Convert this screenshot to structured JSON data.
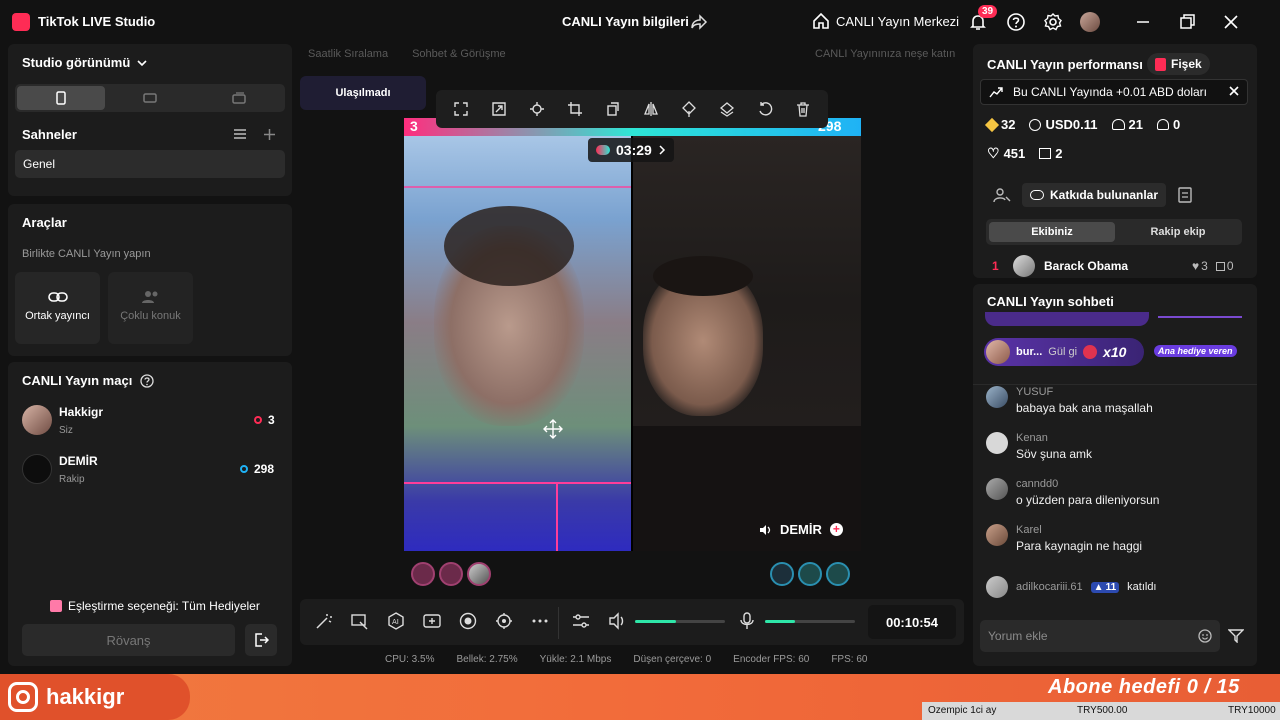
{
  "titlebar": {
    "app_name": "TikTok LIVE Studio",
    "center_title": "CANLI Yayın bilgileri",
    "live_center": "CANLI Yayın Merkezi",
    "notif_count": "39"
  },
  "studio": {
    "view_title": "Studio görünümü",
    "scenes_title": "Sahneler",
    "scene_item": "Genel"
  },
  "tools": {
    "title": "Araçlar",
    "subtitle": "Birlikte CANLI Yayın yapın",
    "cohost": "Ortak yayıncı",
    "multi_guest": "Çoklu konuk"
  },
  "match": {
    "title": "CANLI Yayın maçı",
    "me_name": "Hakkigr",
    "me_role": "Siz",
    "me_score": "3",
    "opp_name": "DEMİR",
    "opp_role": "Rakip",
    "opp_score": "298",
    "pairing": "Eşleştirme seçeneği: Tüm Hediyeler",
    "rematch": "Rövanş"
  },
  "center": {
    "tab1": "Saatlik Sıralama",
    "tab2": "Sohbet & Görüşme",
    "tab3": "CANLI Yayınınıza neşe katın",
    "unreached": "Ulaşılmadı",
    "timer": "03:29",
    "left_score": "3",
    "right_score": "298",
    "opp_label": "DEMİR",
    "live_time": "00:10:54"
  },
  "stats": {
    "cpu": "CPU: 3.5%",
    "memory": "Bellek: 2.75%",
    "upload": "Yükle: 2.1 Mbps",
    "dropped": "Düşen çerçeve: 0",
    "encoder": "Encoder FPS: 60",
    "fps": "FPS: 60"
  },
  "performance": {
    "title": "CANLI Yayın performansı",
    "fisek": "Fişek",
    "banner": "Bu CANLI Yayında +0.01 ABD doları",
    "diamonds": "32",
    "usd": "USD0.11",
    "viewers": "21",
    "new_followers": "0",
    "likes": "451",
    "gifts": "2",
    "contributors": "Katkıda bulunanlar",
    "tab_team": "Ekibiniz",
    "tab_rival": "Rakip ekip",
    "rank": "1",
    "top_name": "Barack Obama",
    "top_likes": "3",
    "top_gifts": "0"
  },
  "chat": {
    "title": "CANLI Yayın sohbeti",
    "gift_user": "bur...",
    "gift_text": "Gül gi",
    "gift_count": "x10",
    "gift_badge": "Ana hediye veren",
    "messages": [
      {
        "name": "YUSUF",
        "text": "babaya bak ana maşallah"
      },
      {
        "name": "Kenan",
        "text": "Söv şuna amk"
      },
      {
        "name": "canndd0",
        "text": "o yüzden para dileniyorsun"
      },
      {
        "name": "Karel",
        "text": "Para kaynagin ne haggi"
      }
    ],
    "join_user": "adilkocariii.61",
    "join_level": "11",
    "join_text": "katıldı",
    "input_placeholder": "Yorum ekle"
  },
  "overlay": {
    "handle": "hakkigr",
    "goal": "Abone hedefi 0 / 15",
    "ticker_item": "Ozempic 1ci ay",
    "ticker_price1": "TRY500.00",
    "ticker_price2": "TRY10000"
  },
  "colors": {
    "accent": "#fe2c55",
    "teal": "#2ee6d6",
    "live_green": "#2ee6a8"
  }
}
